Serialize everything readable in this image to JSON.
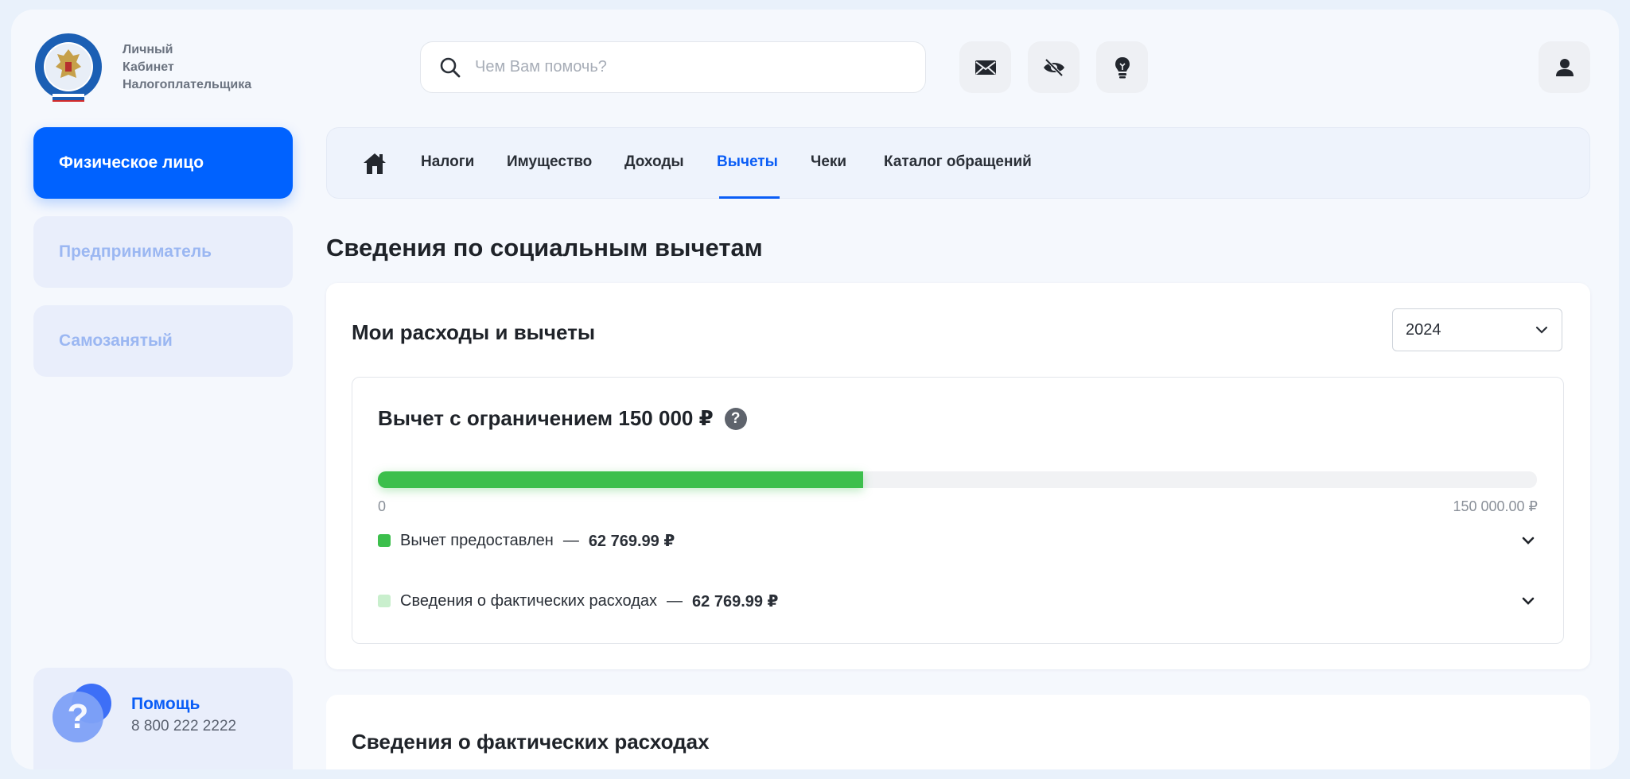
{
  "header": {
    "logo_text_lines": [
      "Личный",
      "Кабинет",
      "Налогоплательщика"
    ],
    "search_placeholder": "Чем Вам помочь?",
    "icons": [
      "mail-icon",
      "eye-off-icon",
      "lightbulb-icon",
      "user-icon"
    ]
  },
  "sidebar": {
    "items": [
      {
        "label": "Физическое лицо",
        "active": true
      },
      {
        "label": "Предприниматель",
        "active": false
      },
      {
        "label": "Самозанятый",
        "active": false
      }
    ],
    "help": {
      "title": "Помощь",
      "phone": "8 800 222 2222"
    }
  },
  "nav": {
    "items": [
      {
        "label": "Налоги"
      },
      {
        "label": "Имущество"
      },
      {
        "label": "Доходы"
      },
      {
        "label": "Вычеты",
        "active": true
      },
      {
        "label": "Чеки"
      },
      {
        "label": "Каталог обращений"
      }
    ]
  },
  "page": {
    "title": "Сведения по социальным вычетам"
  },
  "expenses_card": {
    "title": "Мои расходы и вычеты",
    "year": "2024",
    "limit_block": {
      "title": "Вычет с ограничением 150 000 ₽",
      "progress_fraction": 0.4185,
      "min_label": "0",
      "max_label": "150 000.00 ₽",
      "rows": [
        {
          "label": "Вычет предоставлен",
          "dash": "—",
          "amount": "62 769.99 ₽",
          "color": "#3cbf4c"
        },
        {
          "label": "Сведения о фактических расходах",
          "dash": "—",
          "amount": "62 769.99 ₽",
          "color": "#c9efcd"
        }
      ]
    }
  },
  "actual_expenses_card": {
    "title": "Сведения о фактических расходах"
  },
  "colors": {
    "accent": "#0062ff",
    "progress": "#3cbf4c"
  }
}
